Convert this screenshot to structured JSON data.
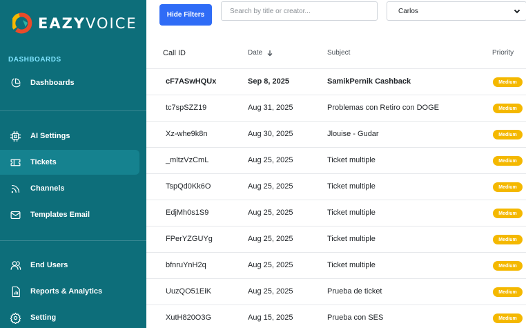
{
  "brand": {
    "name_bold": "EAZY",
    "name_light": "VOICE"
  },
  "sidebar": {
    "section_title": "DASHBOARDS",
    "items": [
      {
        "label": "Dashboards",
        "icon": "pie-chart-icon",
        "active": false
      },
      {
        "label": "AI Settings",
        "icon": "cpu-icon",
        "active": false
      },
      {
        "label": "Tickets",
        "icon": "ticket-icon",
        "active": true
      },
      {
        "label": "Channels",
        "icon": "rss-icon",
        "active": false
      },
      {
        "label": "Templates Email",
        "icon": "mail-icon",
        "active": false
      },
      {
        "label": "End Users",
        "icon": "users-icon",
        "active": false
      },
      {
        "label": "Reports & Analytics",
        "icon": "report-icon",
        "active": false
      },
      {
        "label": "Setting",
        "icon": "gear-icon",
        "active": false
      }
    ]
  },
  "toolbar": {
    "hide_filters_label": "Hide Filters",
    "search_placeholder": "Search by title or creator...",
    "search_value": "",
    "agent_select_value": "Carlos"
  },
  "table": {
    "headers": {
      "call_id": "Call ID",
      "date": "Date",
      "subject": "Subject",
      "priority": "Priority"
    },
    "sort": {
      "column": "date",
      "direction": "descending",
      "icon": "arrow-down-icon"
    },
    "rows": [
      {
        "call_id": "cF7ASwHQUx",
        "date": "Sep 8, 2025",
        "subject": "SamikPernik Cashback",
        "priority": "Medium",
        "unread": true
      },
      {
        "call_id": "tc7spSZZ19",
        "date": "Aug 31, 2025",
        "subject": "Problemas con Retiro con DOGE",
        "priority": "Medium",
        "unread": false
      },
      {
        "call_id": "Xz-whe9k8n",
        "date": "Aug 30, 2025",
        "subject": "Jlouise - Gudar",
        "priority": "Medium",
        "unread": false
      },
      {
        "call_id": "_mltzVzCmL",
        "date": "Aug 25, 2025",
        "subject": "Ticket multiple",
        "priority": "Medium",
        "unread": false
      },
      {
        "call_id": "TspQd0Kk6O",
        "date": "Aug 25, 2025",
        "subject": "Ticket multiple",
        "priority": "Medium",
        "unread": false
      },
      {
        "call_id": "EdjMh0s1S9",
        "date": "Aug 25, 2025",
        "subject": "Ticket multiple",
        "priority": "Medium",
        "unread": false
      },
      {
        "call_id": "FPerYZGUYg",
        "date": "Aug 25, 2025",
        "subject": "Ticket multiple",
        "priority": "Medium",
        "unread": false
      },
      {
        "call_id": "bfnruYnH2q",
        "date": "Aug 25, 2025",
        "subject": "Ticket multiple",
        "priority": "Medium",
        "unread": false
      },
      {
        "call_id": "UuzQO51EiK",
        "date": "Aug 25, 2025",
        "subject": "Prueba de ticket",
        "priority": "Medium",
        "unread": false
      },
      {
        "call_id": "XutH820O3G",
        "date": "Aug 15, 2025",
        "subject": "Prueba con SES",
        "priority": "Medium",
        "unread": false
      }
    ]
  },
  "colors": {
    "sidebar": "#0d6e7a",
    "sidebar_active": "#15828f",
    "accent": "#2f6cf6",
    "badge_medium": "#f4b800",
    "section_title": "#7fe4ff"
  }
}
